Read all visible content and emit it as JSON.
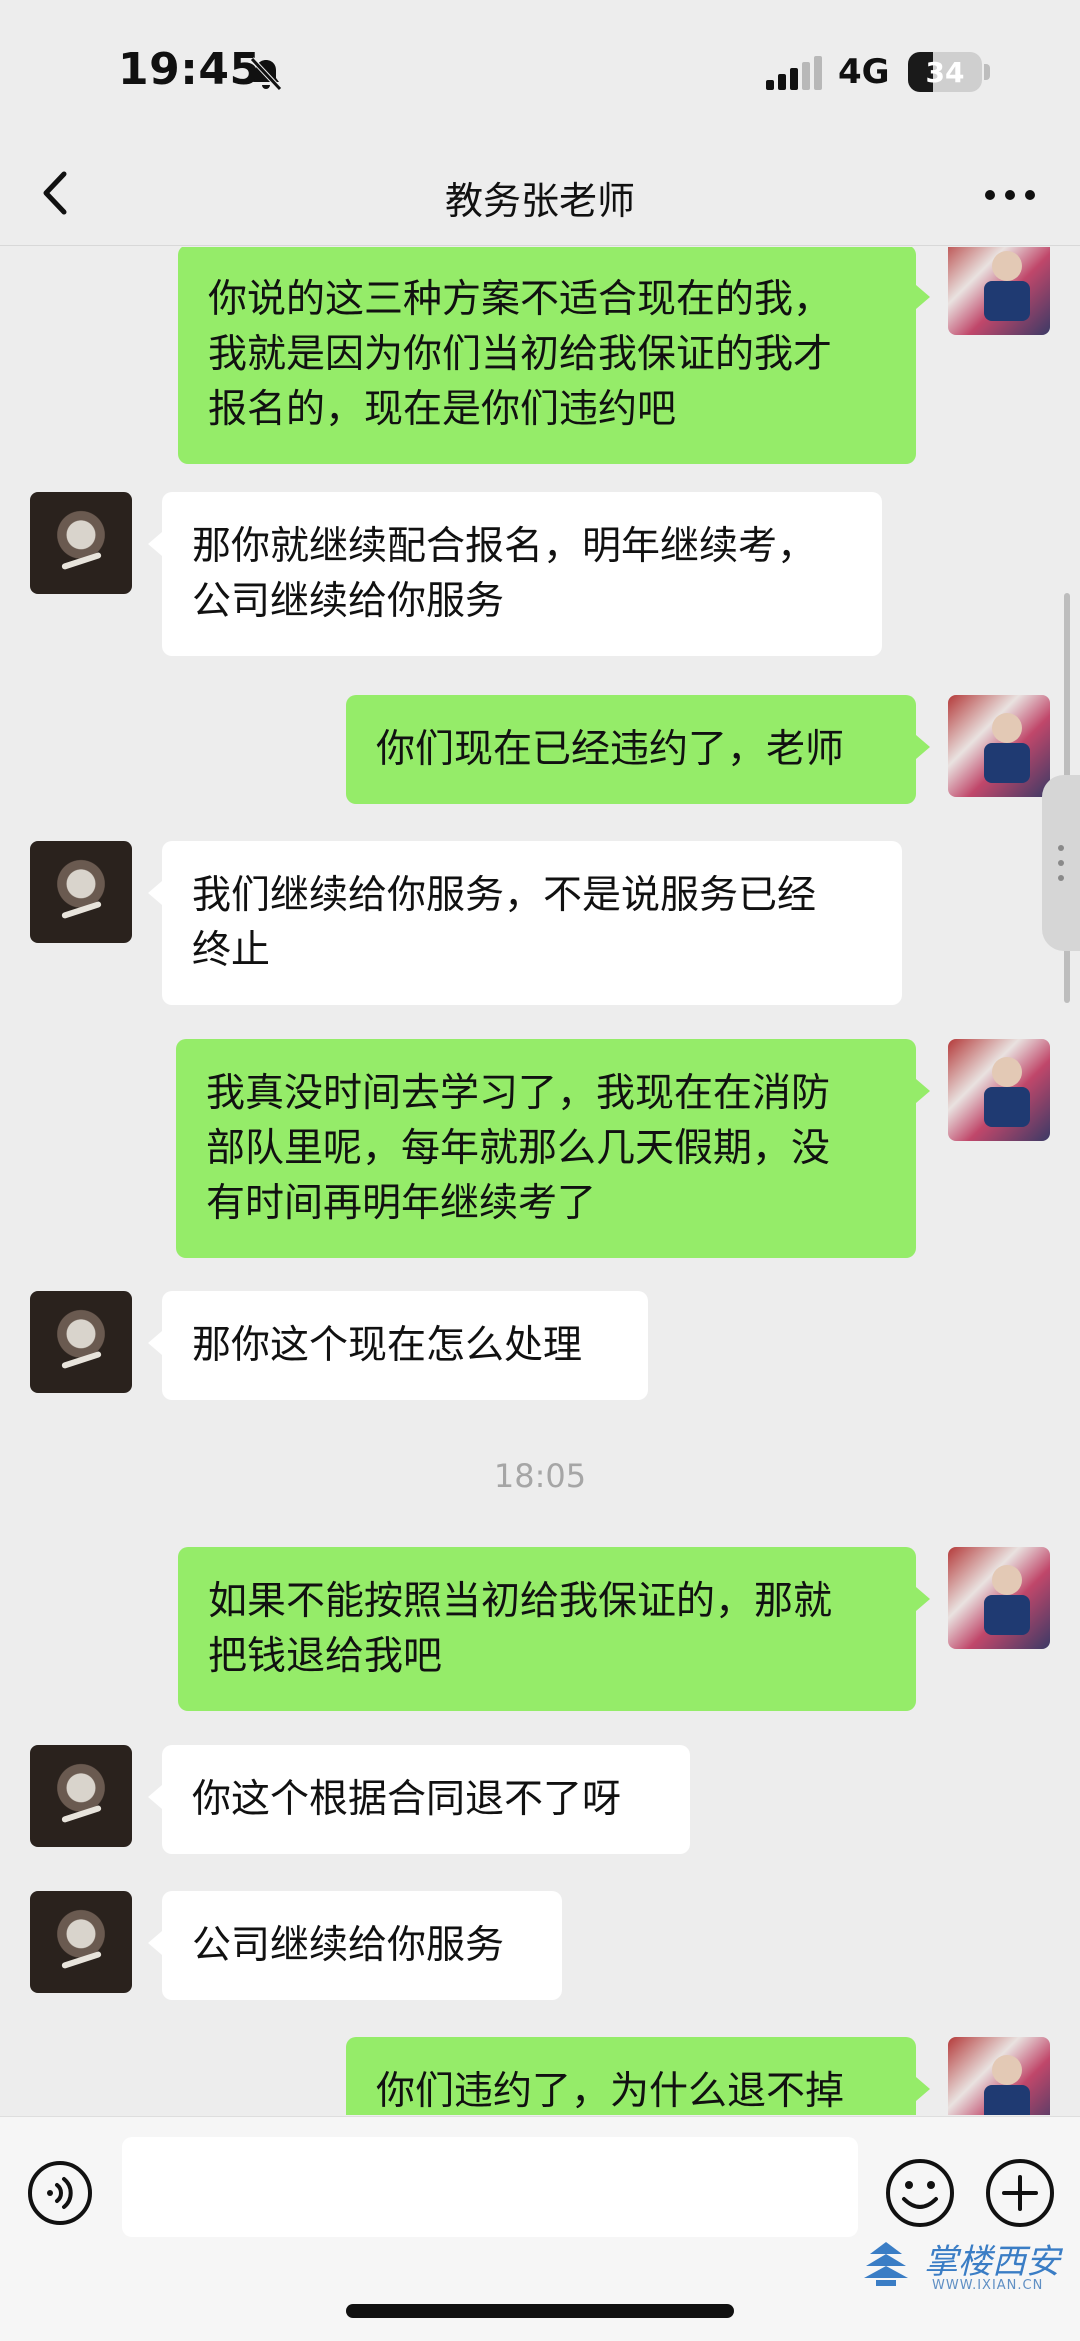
{
  "status_bar": {
    "time": "19:45",
    "network": "4G",
    "battery_level": "34",
    "icons": [
      "bell-muted-icon",
      "signal-icon"
    ]
  },
  "nav": {
    "title": "教务张老师",
    "back_icon": "chevron-left-icon",
    "more_icon": "more-dots-icon"
  },
  "messages": [
    {
      "side": "right",
      "lines": [
        "你说的这三种方案不适合现在的我，",
        "我就是因为你们当初给我保证的我才",
        "报名的，现在是你们违约吧"
      ]
    },
    {
      "side": "left",
      "lines": [
        "那你就继续配合报名，明年继续考，",
        "公司继续给你服务"
      ]
    },
    {
      "side": "right",
      "lines": [
        "你们现在已经违约了，老师"
      ]
    },
    {
      "side": "left",
      "lines": [
        "我们继续给你服务，不是说服务已经",
        "终止"
      ]
    },
    {
      "side": "right",
      "lines": [
        "我真没时间去学习了，我现在在消防",
        "部队里呢，每年就那么几天假期，没",
        "有时间再明年继续考了"
      ]
    },
    {
      "side": "left",
      "lines": [
        "那你这个现在怎么处理"
      ]
    },
    {
      "side": "right",
      "lines": [
        "如果不能按照当初给我保证的，那就",
        "把钱退给我吧"
      ]
    },
    {
      "side": "left",
      "lines": [
        "你这个根据合同退不了呀"
      ]
    },
    {
      "side": "left",
      "lines": [
        "公司继续给你服务"
      ]
    },
    {
      "side": "right",
      "lines": [
        "你们违约了，为什么退不掉"
      ]
    }
  ],
  "timestamp": "18:05",
  "input_bar": {
    "voice_icon": "voice-icon",
    "text_value": "",
    "emoji_icon": "emoji-icon",
    "plus_icon": "plus-icon"
  },
  "watermark": {
    "name": "掌楼西安",
    "url": "WWW.IXIAN.CN"
  },
  "colors": {
    "background": "#ededed",
    "bubble_self": "#95ec69",
    "bubble_other": "#ffffff",
    "timestamp": "#a6a6a6"
  }
}
